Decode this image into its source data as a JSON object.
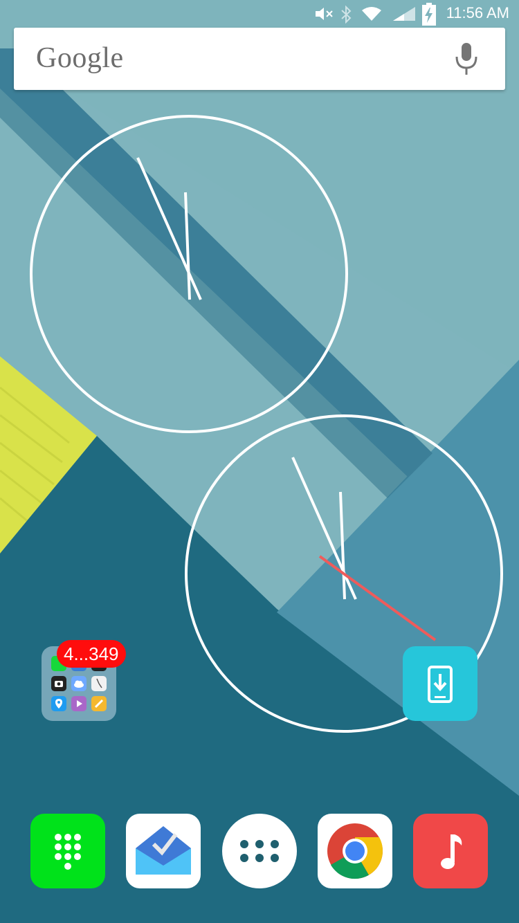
{
  "status_bar": {
    "time": "11:56 AM",
    "icons": [
      "mute-icon",
      "bluetooth-icon",
      "wifi-icon",
      "signal-icon",
      "battery-charging-icon"
    ]
  },
  "search_widget": {
    "logo_text": "Google",
    "icons": [
      "mic-icon"
    ]
  },
  "home_screen": {
    "clock_widgets": 2,
    "folder": {
      "badge": "4...349",
      "icons": [
        "phone-icon",
        "camera-icon",
        "cloud-icon",
        "clock-icon",
        "maps-icon",
        "video-icon",
        "notes-icon"
      ]
    },
    "shortcut": {
      "icon": "phone-download-icon"
    }
  },
  "dock": {
    "apps": [
      {
        "icon": "dialer-icon",
        "color": "#00e21a"
      },
      {
        "icon": "inbox-icon",
        "color": "#ffffff"
      },
      {
        "icon": "app-drawer-icon",
        "color": "#ffffff"
      },
      {
        "icon": "chrome-icon",
        "color": "#ffffff"
      },
      {
        "icon": "music-icon",
        "color": "#f04848"
      }
    ]
  },
  "colors": {
    "wallpaper_light": "#7fb4bd",
    "wallpaper_dark": "#1f6a80",
    "wallpaper_stripe": "#3c7f98",
    "wallpaper_yellow": "#d9e24a",
    "accent_teal": "#26c6da",
    "badge_red": "#ff0d0d"
  }
}
